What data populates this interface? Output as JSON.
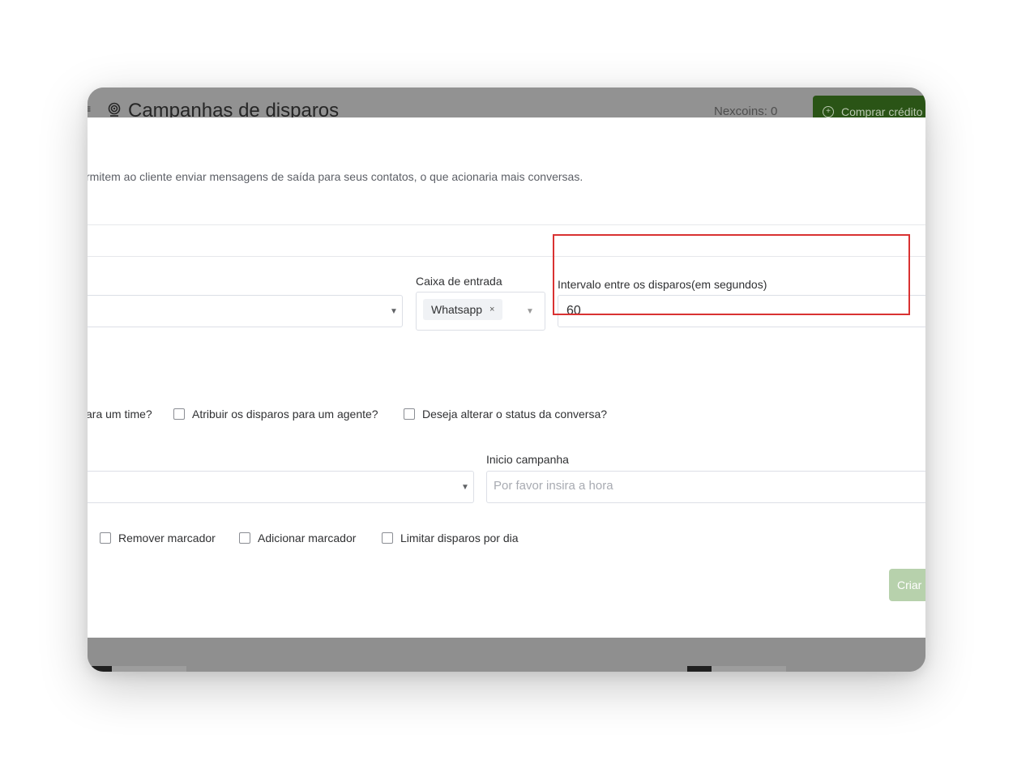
{
  "header": {
    "title": "Campanhas de disparos",
    "nexcoins": "Nexcoins: 0",
    "buy_button": "Comprar crédito"
  },
  "modal": {
    "description": "rmitem ao cliente enviar mensagens de saída para seus contatos, o que acionaria mais conversas.",
    "inbox": {
      "label": "Caixa de entrada",
      "selected_tag": "Whatsapp",
      "tag_remove": "×"
    },
    "interval": {
      "label": "Intervalo entre os disparos(em segundos)",
      "value": "60"
    },
    "checkboxes_row1": {
      "team": "ara um time?",
      "agent": "Atribuir os disparos para um agente?",
      "status": "Deseja alterar o status da conversa?"
    },
    "start": {
      "label": "Inicio campanha",
      "placeholder": "Por favor insira a hora"
    },
    "checkboxes_row2": {
      "remove_tag": "Remover marcador",
      "add_tag": "Adicionar marcador",
      "limit": "Limitar disparos por dia"
    },
    "create_button": "Criar"
  },
  "colors": {
    "accent_green": "#2a5416",
    "disabled_green": "#b7d1ac",
    "highlight_red": "#d93232"
  },
  "icons": [
    "menu-icon",
    "broadcast-icon",
    "plus-circle-icon",
    "dropdown-caret-icon",
    "close-icon"
  ]
}
